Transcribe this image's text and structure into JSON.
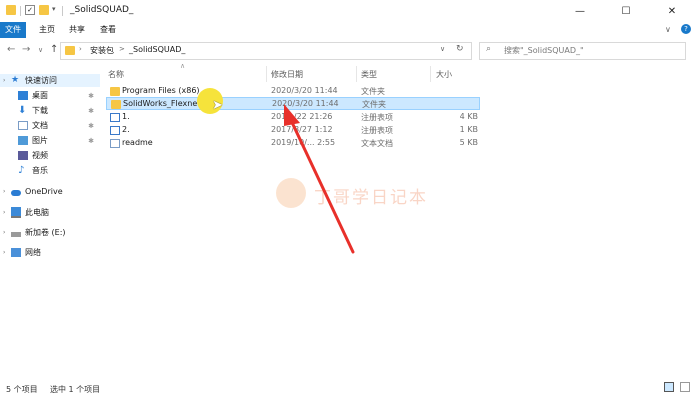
{
  "window": {
    "title": "_SolidSQUAD_",
    "minimize_glyph": "—",
    "maximize_glyph": "☐",
    "close_glyph": "✕"
  },
  "ribbon": {
    "tabs": [
      "文件",
      "主页",
      "共享",
      "查看"
    ]
  },
  "address": {
    "back_glyph": "←",
    "forward_glyph": "→",
    "recent_glyph": "∨",
    "up_glyph": "↑",
    "breadcrumb_root": "安装包",
    "breadcrumb_sep": ">",
    "breadcrumb_current": "_SolidSQUAD_",
    "dropdown_glyph": "∨",
    "refresh_glyph": "↻",
    "search_placeholder": "搜索\"_SolidSQUAD_\""
  },
  "sidebar": {
    "items": [
      {
        "label": "快速访问",
        "icon": "star-icon"
      },
      {
        "label": "桌面",
        "icon": "desktop-icon",
        "pinned": true
      },
      {
        "label": "下载",
        "icon": "download-icon",
        "pinned": true
      },
      {
        "label": "文档",
        "icon": "document-icon",
        "pinned": true
      },
      {
        "label": "图片",
        "icon": "picture-icon",
        "pinned": true
      },
      {
        "label": "视频",
        "icon": "video-icon"
      },
      {
        "label": "音乐",
        "icon": "music-icon"
      },
      {
        "label": "OneDrive",
        "icon": "cloud-icon"
      },
      {
        "label": "此电脑",
        "icon": "computer-icon"
      },
      {
        "label": "新加卷 (E:)",
        "icon": "drive-icon"
      },
      {
        "label": "网络",
        "icon": "network-icon"
      }
    ],
    "pin_glyph": "✱"
  },
  "columns": {
    "name": "名称",
    "date": "修改日期",
    "type": "类型",
    "size": "大小"
  },
  "files": [
    {
      "name": "Program Files (x86)",
      "date": "2020/3/20 11:44",
      "type": "文件夹",
      "size": "",
      "icon": "folder-icon"
    },
    {
      "name": "SolidWorks_Flexnet_S",
      "date": "2020/3/20 11:44",
      "type": "文件夹",
      "size": "",
      "icon": "folder-icon",
      "selected": true
    },
    {
      "name": "1.",
      "date": "201.../22 21:26",
      "type": "注册表项",
      "size": "4 KB",
      "icon": "registry-icon"
    },
    {
      "name": "2.",
      "date": "2017/8/27 1:12",
      "type": "注册表项",
      "size": "1 KB",
      "icon": "registry-icon"
    },
    {
      "name": "readme",
      "date": "2019/10/... 2:55",
      "type": "文本文档",
      "size": "5 KB",
      "icon": "text-file-icon"
    }
  ],
  "status": {
    "item_count": "5 个项目",
    "selected": "选中 1 个项目"
  },
  "watermark": {
    "text": "丁哥学日记本"
  },
  "colors": {
    "accent": "#1979ca",
    "folder": "#f6c644",
    "selection": "#cce8ff",
    "arrow": "#e8302a"
  }
}
